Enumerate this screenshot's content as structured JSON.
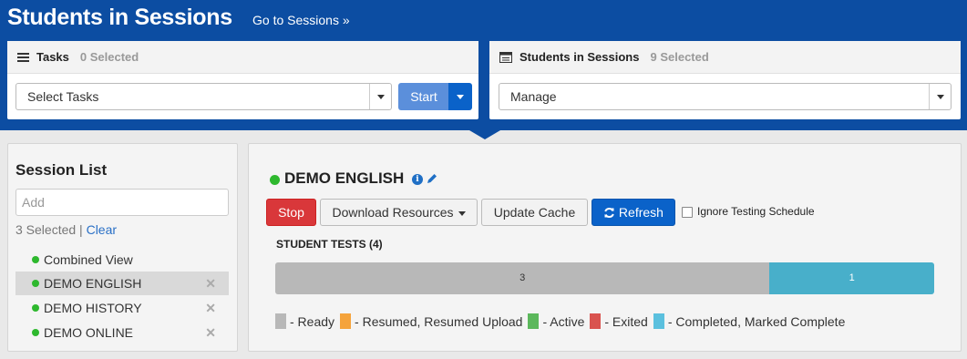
{
  "header": {
    "title": "Students in Sessions",
    "link": "Go to Sessions »",
    "color": "#0c4da2"
  },
  "tasks_panel": {
    "label": "Tasks",
    "count": "0 Selected",
    "select_value": "Select Tasks",
    "start_label": "Start"
  },
  "sessions_panel": {
    "label": "Students in Sessions",
    "count": "9 Selected",
    "select_value": "Manage"
  },
  "session_list": {
    "title": "Session List",
    "add_placeholder": "Add",
    "selected_text": "3 Selected |",
    "clear_label": "Clear",
    "items": [
      {
        "label": "Combined View",
        "removable": false,
        "active": false
      },
      {
        "label": "DEMO ENGLISH",
        "removable": true,
        "active": true
      },
      {
        "label": "DEMO HISTORY",
        "removable": true,
        "active": false
      },
      {
        "label": "DEMO ONLINE",
        "removable": true,
        "active": false
      }
    ]
  },
  "detail": {
    "title": "DEMO ENGLISH",
    "buttons": {
      "stop": "Stop",
      "download": "Download Resources",
      "cache": "Update Cache",
      "refresh": "Refresh"
    },
    "ignore_label": "Ignore Testing Schedule",
    "ignore_checked": false,
    "tests_title": "STUDENT TESTS (4)",
    "progress": [
      {
        "status": "Ready",
        "count": "3",
        "color": "#b8b8b8"
      },
      {
        "status": "Completed, Marked Complete",
        "count": "1",
        "color": "#48afca"
      }
    ],
    "legend": [
      {
        "label": "- Ready",
        "color": "#b8b8b8"
      },
      {
        "label": "- Resumed, Resumed Upload",
        "color": "#f5a33b"
      },
      {
        "label": "- Active",
        "color": "#5cb85c"
      },
      {
        "label": "- Exited",
        "color": "#d9534f"
      },
      {
        "label": "- Completed, Marked Complete",
        "color": "#5bc0de"
      }
    ]
  },
  "icons": {
    "status": "green-dot-icon",
    "info": "info-icon",
    "edit": "pencil-icon",
    "refresh": "refresh-icon",
    "remove": "close-icon"
  }
}
